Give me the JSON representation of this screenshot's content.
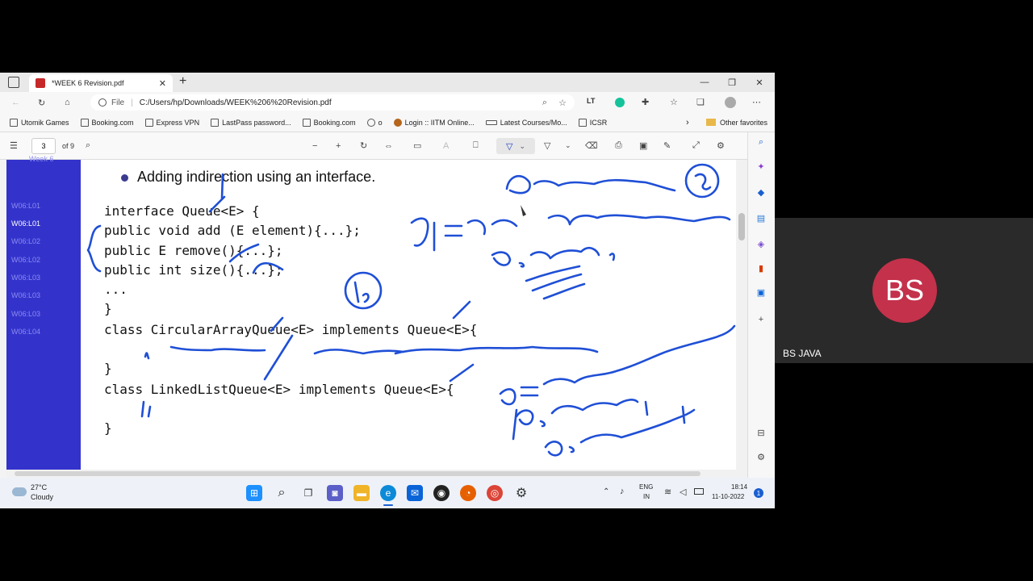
{
  "browser": {
    "tab_title": "*WEEK 6 Revision.pdf",
    "address_prefix": "File",
    "url": "C:/Users/hp/Downloads/WEEK%206%20Revision.pdf"
  },
  "favorites": [
    {
      "label": "Utomik Games"
    },
    {
      "label": "Booking.com"
    },
    {
      "label": "Express VPN"
    },
    {
      "label": "LastPass password..."
    },
    {
      "label": "Booking.com"
    },
    {
      "label": "o"
    },
    {
      "label": "Login :: IITM Online..."
    },
    {
      "label": "Latest Courses/Mo..."
    },
    {
      "label": "ICSR"
    }
  ],
  "other_favorites": "Other favorites",
  "pdf_toolbar": {
    "page_number": "3",
    "page_total": "of 9"
  },
  "outline": {
    "header": "Week 6",
    "items": [
      {
        "label": "W06:L01",
        "active": false
      },
      {
        "label": "W06:L01",
        "active": true
      },
      {
        "label": "W06:L02",
        "active": false
      },
      {
        "label": "W06:L02",
        "active": false
      },
      {
        "label": "W06:L03",
        "active": false
      },
      {
        "label": "W06:L03",
        "active": false
      },
      {
        "label": "W06:L03",
        "active": false
      },
      {
        "label": "W06:L04",
        "active": false
      }
    ]
  },
  "slide": {
    "bullet": "Adding indirection using an interface.",
    "code_lines": [
      "interface Queue<E> {",
      "public void add (E element){...};",
      "public E remove(){...};",
      "public int size(){...};",
      "...",
      "}",
      "class CircularArrayQueue<E> implements Queue<E>{",
      "",
      "}",
      "class LinkedListQueue<E> implements Queue<E>{",
      "",
      "}"
    ]
  },
  "taskbar": {
    "weather_temp": "27°C",
    "weather_desc": "Cloudy",
    "lang_line1": "ENG",
    "lang_line2": "IN",
    "time": "18:14",
    "date": "11-10-2022",
    "notif_count": "1"
  },
  "participant": {
    "initials": "BS",
    "name": "BS JAVA",
    "avatar_color": "#c4314b"
  }
}
